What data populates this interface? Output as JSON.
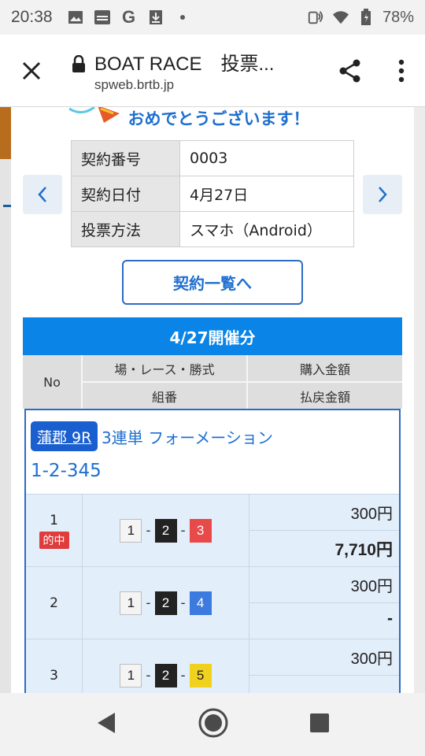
{
  "status": {
    "time": "20:38",
    "battery": "78%",
    "icons": [
      "image-icon",
      "au-pay-icon",
      "google-icon",
      "download-icon",
      "dot-icon",
      "nfc-icon",
      "wifi-icon",
      "battery-icon"
    ]
  },
  "browser": {
    "title": "BOAT RACE　投票...",
    "url": "spweb.brtb.jp"
  },
  "congrats_text": "おめでとうございます！",
  "contract": {
    "rows": [
      {
        "label": "契約番号",
        "value": "0003"
      },
      {
        "label": "契約日付",
        "value": "4月27日"
      },
      {
        "label": "投票方法",
        "value": "スマホ（Android）"
      }
    ]
  },
  "list_button": "契約一覧へ",
  "day_header": "4/27開催分",
  "headers": {
    "no": "No",
    "race": "場・レース・勝式",
    "combo": "組番",
    "purchase": "購入金額",
    "payout": "払戻金額"
  },
  "bet": {
    "venue": "蒲郡 9R",
    "type": "3連単 フォーメーション",
    "formation": "1-2-345",
    "hit_label": "的中",
    "rows": [
      {
        "no": "1",
        "hit": true,
        "combo": [
          "1",
          "2",
          "3"
        ],
        "purchase": "300円",
        "payout": "7,710円"
      },
      {
        "no": "2",
        "hit": false,
        "combo": [
          "1",
          "2",
          "4"
        ],
        "purchase": "300円",
        "payout": "-"
      },
      {
        "no": "3",
        "hit": false,
        "combo": [
          "1",
          "2",
          "5"
        ],
        "purchase": "300円",
        "payout": ""
      }
    ]
  },
  "colors": {
    "accent_blue": "#0a84e6",
    "link_blue": "#1e6fd0",
    "hit_red": "#e03c3c",
    "row_bg": "#e3eefb"
  }
}
